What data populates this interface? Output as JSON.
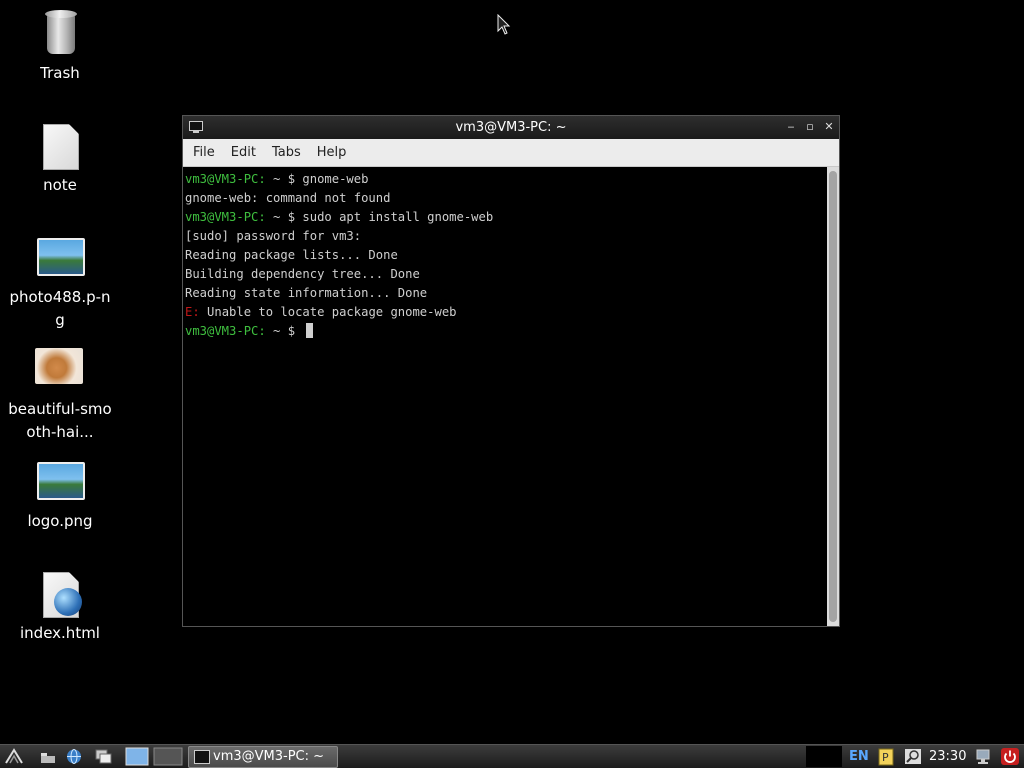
{
  "desktop": {
    "icons": [
      {
        "label": "Trash"
      },
      {
        "label": "note"
      },
      {
        "label": "photo488.p-ng"
      },
      {
        "label": "beautiful-smooth-hai..."
      },
      {
        "label": "logo.png"
      },
      {
        "label": "index.html"
      }
    ]
  },
  "terminal": {
    "title": "vm3@VM3-PC: ~",
    "menu": [
      "File",
      "Edit",
      "Tabs",
      "Help"
    ],
    "prompt": "vm3@VM3-PC:",
    "prompt_suffix": " ~ $ ",
    "lines": [
      {
        "cmd": "gnome-web"
      },
      {
        "out": "gnome-web: command not found"
      },
      {
        "cmd": "sudo apt install gnome-web"
      },
      {
        "out": "[sudo] password for vm3:"
      },
      {
        "out": "Reading package lists... Done"
      },
      {
        "out": "Building dependency tree... Done"
      },
      {
        "out": "Reading state information... Done"
      },
      {
        "err": "E:",
        "out": " Unable to locate package gnome-web"
      }
    ],
    "colors": {
      "prompt": "#3fbf3f",
      "error": "#c01818",
      "text": "#cfcfcf"
    }
  },
  "taskbar": {
    "window_button_label": "vm3@VM3-PC: ~",
    "language": "EN",
    "clock": "23:30"
  }
}
